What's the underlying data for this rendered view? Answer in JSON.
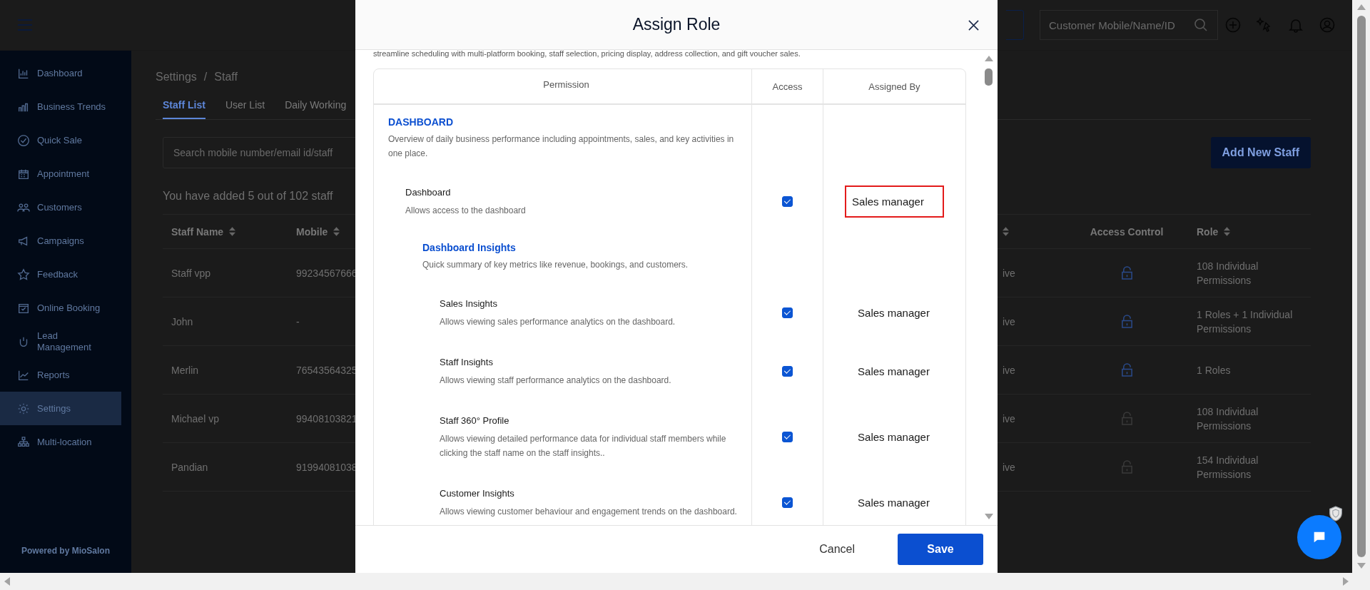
{
  "top_bar": {
    "search": {
      "placeholder": "Customer Mobile/Name/ID"
    }
  },
  "sidebar": {
    "items": [
      {
        "label": "Dashboard",
        "selected": false
      },
      {
        "label": "Business Trends",
        "selected": false
      },
      {
        "label": "Quick Sale",
        "selected": false
      },
      {
        "label": "Appointment",
        "selected": false
      },
      {
        "label": "Customers",
        "selected": false
      },
      {
        "label": "Campaigns",
        "selected": false
      },
      {
        "label": "Feedback",
        "selected": false
      },
      {
        "label": "Online Booking",
        "selected": false
      },
      {
        "label": "Lead Management",
        "selected": false
      },
      {
        "label": "Reports",
        "selected": false
      },
      {
        "label": "Settings",
        "selected": true
      },
      {
        "label": "Multi-location",
        "selected": false
      }
    ],
    "footer": "Powered by MioSalon"
  },
  "breadcrumb": {
    "items": [
      "Settings",
      "Staff"
    ],
    "separator": "/"
  },
  "tabs": [
    {
      "label": "Staff List",
      "selected": true
    },
    {
      "label": "User List",
      "selected": false
    },
    {
      "label": "Daily Working",
      "selected": false
    }
  ],
  "staff_search": {
    "placeholder": "Search mobile number/email id/staff"
  },
  "add_button": "Add New Staff",
  "staff_count": "You have added 5 out of 102 staff",
  "table": {
    "columns": [
      {
        "label": "Staff Name",
        "sortable": true
      },
      {
        "label": "Mobile",
        "sortable": true
      },
      {
        "sortable": true
      },
      {
        "label": "Access Control",
        "sortable": false
      },
      {
        "label": "Role",
        "sortable": true
      }
    ],
    "rows": [
      {
        "staff_name": "Staff vpp",
        "mobile": "99234567666",
        "column_3": "ive",
        "lock_disabled": false,
        "role": "108 Individual Permissions"
      },
      {
        "staff_name": "John",
        "mobile": "-",
        "column_3": "ive",
        "lock_disabled": false,
        "role": "1 Roles + 1 Individual Permissions"
      },
      {
        "staff_name": "Merlin",
        "mobile": "76543564325",
        "column_3": "ive",
        "lock_disabled": false,
        "role": "1 Roles"
      },
      {
        "staff_name": "Michael vp",
        "mobile": "99408103821",
        "column_3": "ive",
        "lock_disabled": true,
        "role": "108 Individual Permissions"
      },
      {
        "staff_name": "Pandian",
        "mobile": "91994081038",
        "column_3": "ive",
        "lock_disabled": true,
        "role": "154 Individual Permissions"
      }
    ]
  },
  "modal": {
    "title": "Assign Role",
    "intro": "streamline scheduling with multi-platform booking, staff selection, pricing display, address collection, and gift voucher sales.",
    "columns": [
      "Permission",
      "Access",
      "Assigned By"
    ],
    "rows": [
      {
        "kind": "group",
        "title": "DASHBOARD",
        "description": "Overview of daily business performance including appointments, sales, and key activities in one place.",
        "children": [
          {
            "kind": "permission",
            "title": "Dashboard",
            "description": "Allows access to the dashboard",
            "checked": true,
            "assigned_by": "Sales manager",
            "highlighted": true,
            "children": [
              {
                "kind": "group",
                "title": "Dashboard Insights",
                "description": "Quick summary of key metrics like revenue, bookings, and customers.",
                "children": [
                  {
                    "kind": "permission",
                    "title": "Sales Insights",
                    "description": "Allows viewing sales performance analytics on the dashboard.",
                    "checked": true,
                    "assigned_by": "Sales manager",
                    "highlighted": false
                  },
                  {
                    "kind": "permission",
                    "title": "Staff Insights",
                    "description": "Allows viewing staff performance analytics on the dashboard.",
                    "checked": true,
                    "assigned_by": "Sales manager",
                    "highlighted": false
                  },
                  {
                    "kind": "permission",
                    "title": "Staff 360° Profile",
                    "description": "Allows viewing detailed performance data for individual staff members while clicking the staff name on the staff insights..",
                    "checked": true,
                    "assigned_by": "Sales manager",
                    "highlighted": false
                  },
                  {
                    "kind": "permission",
                    "title": "Customer Insights",
                    "description": "Allows viewing customer behaviour and engagement trends on the dashboard.",
                    "checked": true,
                    "assigned_by": "Sales manager",
                    "highlighted": false
                  }
                ]
              }
            ]
          }
        ]
      }
    ],
    "buttons": {
      "cancel": "Cancel",
      "save": "Save"
    }
  }
}
